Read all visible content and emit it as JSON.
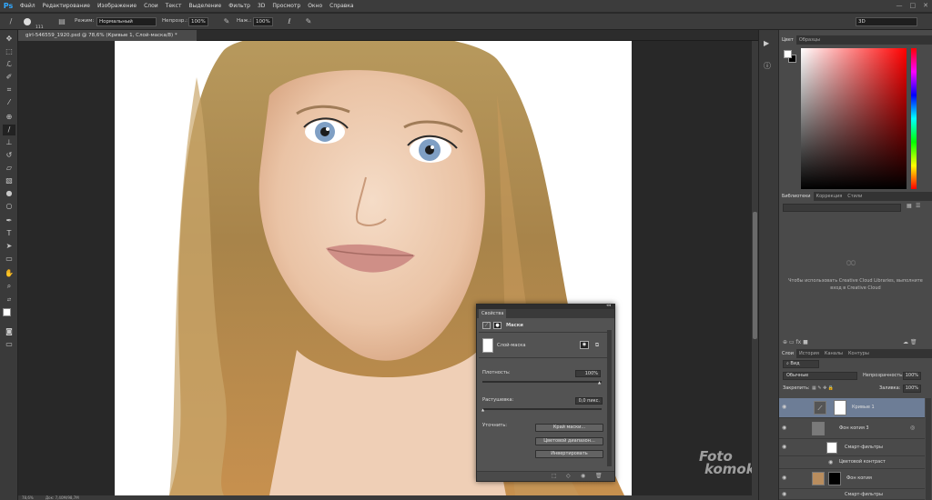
{
  "app": {
    "logo": "Ps"
  },
  "menu": [
    "Файл",
    "Редактирование",
    "Изображение",
    "Слои",
    "Текст",
    "Выделение",
    "Фильтр",
    "3D",
    "Просмотр",
    "Окно",
    "Справка"
  ],
  "options": {
    "brush_size": "111",
    "mode_label": "Режим:",
    "mode_value": "Нормальный",
    "opacity_label": "Непрозр.:",
    "opacity_value": "100%",
    "flow_label": "Наж.:",
    "flow_value": "100%",
    "workspace": "3D"
  },
  "document": {
    "tab_title": "girl-546559_1920.psd @ 78,6% (Кривые 1, Слой-маска/8) *",
    "zoom": "78,6%",
    "doc_size": "Док: 7,40М/98,7М"
  },
  "color_panel": {
    "tabs": [
      "Цвет",
      "Образцы"
    ]
  },
  "libraries_panel": {
    "tabs": [
      "Библиотеки",
      "Коррекция",
      "Стили"
    ],
    "message": "Чтобы использовать Creative Cloud Libraries, выполните вход в Creative Cloud"
  },
  "layers_panel": {
    "tabs": [
      "Слои",
      "История",
      "Каналы",
      "Контуры"
    ],
    "filter": "Вид",
    "blend_mode": "Обычные",
    "opacity_label": "Непрозрачность:",
    "opacity_value": "100%",
    "lock_label": "Закрепить:",
    "fill_label": "Заливка:",
    "fill_value": "100%",
    "layers": [
      {
        "name": "Кривые 1"
      },
      {
        "name": "Фон копия 3"
      },
      {
        "name": "Смарт-фильтры"
      },
      {
        "name": "Цветовой контраст"
      },
      {
        "name": "Фон копия"
      },
      {
        "name": "Смарт-фильтры"
      }
    ]
  },
  "properties_panel": {
    "tab": "Свойства",
    "section": "Маски",
    "mask_label": "Слой-маска",
    "density_label": "Плотность:",
    "density_value": "100%",
    "feather_label": "Растушевка:",
    "feather_value": "0,0 пикс.",
    "refine_label": "Уточнить:",
    "btn_mask_edge": "Край маски...",
    "btn_color_range": "Цветовой диапазон...",
    "btn_invert": "Инвертировать"
  },
  "watermark": {
    "line1": "Foto",
    "line2": "komok.ru"
  },
  "colors": {
    "fg": "#ffffff",
    "bg": "#000000",
    "selected_layer": "#6d7d96",
    "ps_blue": "#31a8ff"
  }
}
